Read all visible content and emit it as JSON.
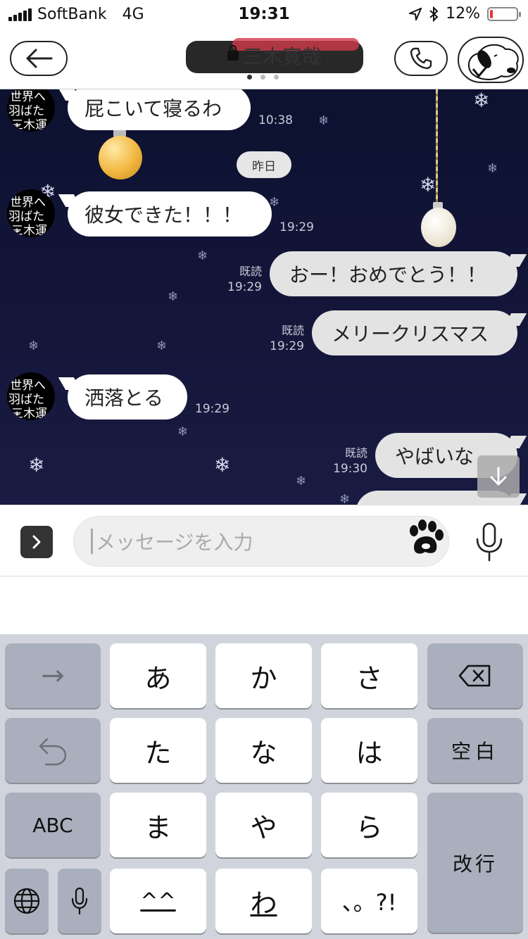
{
  "status_bar": {
    "carrier": "SoftBank",
    "network": "4G",
    "time": "19:31",
    "battery": "12%",
    "battery_level": 0.12
  },
  "header": {
    "title": "三木寛哉"
  },
  "chat": {
    "messages": [
      {
        "direction": "in",
        "text": "屁こいて寝るわ",
        "time": "10:38"
      },
      {
        "direction": "date",
        "text": "昨日"
      },
      {
        "direction": "in",
        "text": "彼女できた！！！",
        "time": "19:29"
      },
      {
        "direction": "out",
        "text": "おー！おめでとう！！",
        "read": "既読",
        "time": "19:29"
      },
      {
        "direction": "out",
        "text": "メリークリスマス",
        "read": "既読",
        "time": "19:29"
      },
      {
        "direction": "in",
        "text": "洒落とる",
        "time": "19:29"
      },
      {
        "direction": "out",
        "text": "やばいな",
        "read": "既読",
        "time": "19:30"
      }
    ],
    "avatar_text": [
      "世界へ",
      "羽ばたけ",
      "三木運"
    ]
  },
  "input": {
    "placeholder": "メッセージを入力"
  },
  "keyboard": {
    "keys": {
      "arrow": "→",
      "a": "あ",
      "ka": "か",
      "sa": "さ",
      "ta": "た",
      "na": "な",
      "ha": "は",
      "space": "空白",
      "abc": "ABC",
      "ma": "ま",
      "ya": "や",
      "ra": "ら",
      "enter": "改行",
      "kaomoji": "^^",
      "wa": "わ",
      "punct": "、。?!"
    }
  }
}
